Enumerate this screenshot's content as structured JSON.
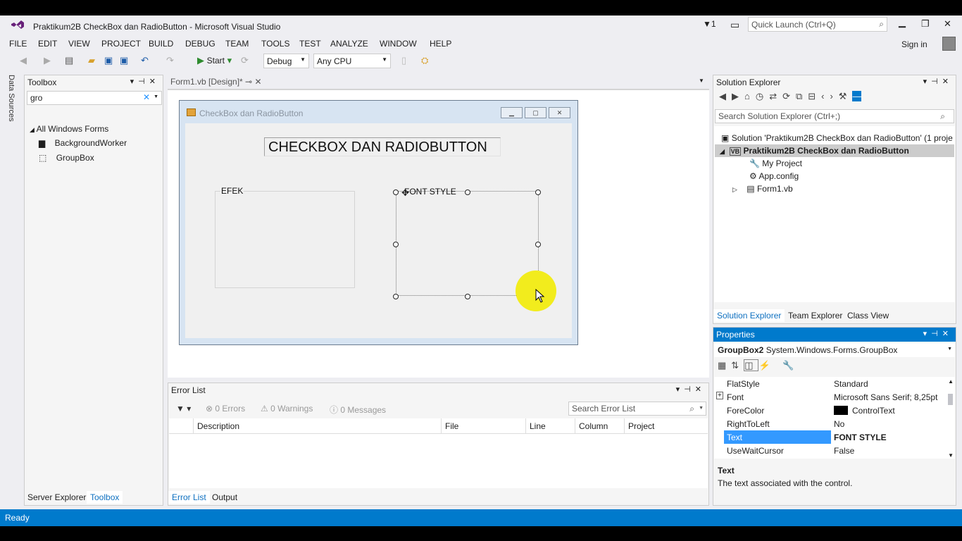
{
  "window": {
    "title": "Praktikum2B CheckBox dan RadioButton - Microsoft Visual Studio",
    "notifications": "1",
    "quick_launch_placeholder": "Quick Launch (Ctrl+Q)",
    "sign_in": "Sign in"
  },
  "menu": [
    "FILE",
    "EDIT",
    "VIEW",
    "PROJECT",
    "BUILD",
    "DEBUG",
    "TEAM",
    "TOOLS",
    "TEST",
    "ANALYZE",
    "WINDOW",
    "HELP"
  ],
  "toolbar": {
    "start_label": "Start",
    "config": "Debug",
    "platform": "Any CPU"
  },
  "side_strip": "Data Sources",
  "toolbox": {
    "title": "Toolbox",
    "search_value": "gro",
    "category": "All Windows Forms",
    "items": [
      "BackgroundWorker",
      "GroupBox"
    ],
    "tabs": [
      "Server Explorer",
      "Toolbox"
    ]
  },
  "doc_tab": "Form1.vb [Design]*",
  "form": {
    "title": "CheckBox dan RadioButton",
    "label_title": "CHECKBOX DAN RADIOBUTTON",
    "group1": "EFEK",
    "group2": "FONT STYLE"
  },
  "error_list": {
    "title": "Error List",
    "errors": "0 Errors",
    "warnings": "0 Warnings",
    "messages": "0 Messages",
    "search_placeholder": "Search Error List",
    "columns": [
      "Description",
      "File",
      "Line",
      "Column",
      "Project"
    ],
    "tabs": [
      "Error List",
      "Output"
    ]
  },
  "solution_explorer": {
    "title": "Solution Explorer",
    "search_placeholder": "Search Solution Explorer (Ctrl+;)",
    "solution": "Solution 'Praktikum2B CheckBox dan RadioButton' (1 proje",
    "project": "Praktikum2B CheckBox dan RadioButton",
    "items": [
      "My Project",
      "App.config",
      "Form1.vb"
    ],
    "tabs": [
      "Solution Explorer",
      "Team Explorer",
      "Class View"
    ]
  },
  "properties": {
    "title": "Properties",
    "object_name": "GroupBox2",
    "object_type": "System.Windows.Forms.GroupBox",
    "rows": [
      {
        "name": "FlatStyle",
        "value": "Standard"
      },
      {
        "name": "Font",
        "value": "Microsoft Sans Serif; 8,25pt"
      },
      {
        "name": "ForeColor",
        "value": "ControlText"
      },
      {
        "name": "RightToLeft",
        "value": "No"
      },
      {
        "name": "Text",
        "value": "FONT STYLE"
      },
      {
        "name": "UseWaitCursor",
        "value": "False"
      }
    ],
    "desc_title": "Text",
    "desc_text": "The text associated with the control."
  },
  "status": "Ready",
  "colors": {
    "accent": "#007acc",
    "cursor_highlight": "#f2ec1d"
  }
}
